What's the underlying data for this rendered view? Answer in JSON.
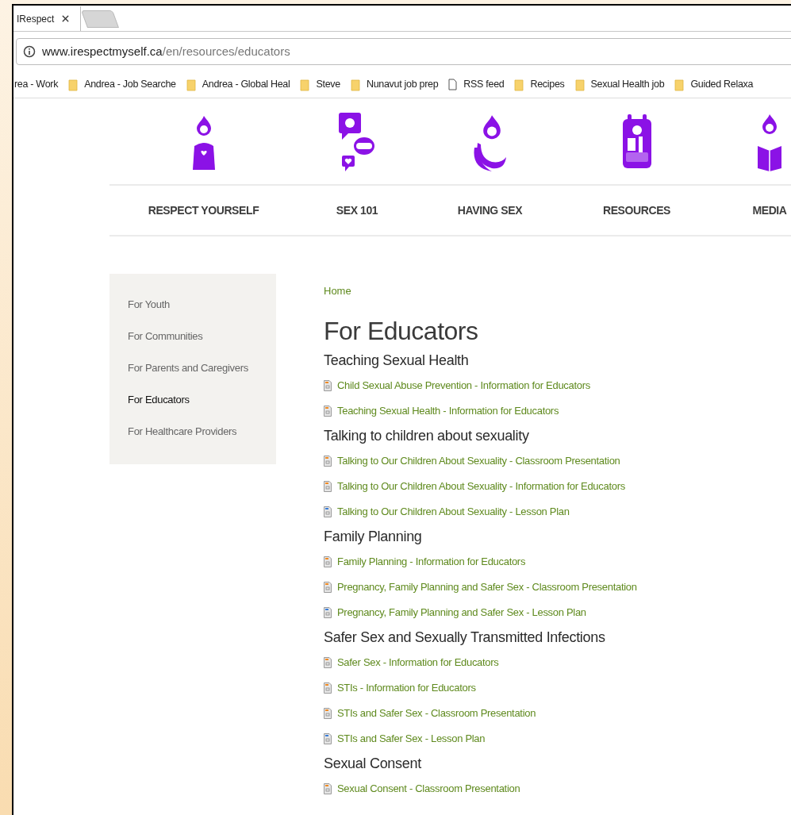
{
  "browser": {
    "tab": {
      "title": "IRespect"
    },
    "address": {
      "host": "www.irespectmyself.ca",
      "path": "/en/resources/educators"
    },
    "bookmarks": [
      {
        "label": "rea - Work",
        "kind": "none"
      },
      {
        "label": "Andrea - Job Searche",
        "kind": "folder"
      },
      {
        "label": "Andrea - Global Heal",
        "kind": "folder"
      },
      {
        "label": "Steve",
        "kind": "folder"
      },
      {
        "label": "Nunavut job prep",
        "kind": "folder"
      },
      {
        "label": "RSS feed",
        "kind": "page"
      },
      {
        "label": "Recipes",
        "kind": "folder"
      },
      {
        "label": "Sexual Health job",
        "kind": "folder"
      },
      {
        "label": "Guided Relaxa",
        "kind": "folder"
      }
    ]
  },
  "nav": [
    {
      "label": "RESPECT YOURSELF",
      "kind": "person"
    },
    {
      "label": "SEX 101",
      "kind": "chat"
    },
    {
      "label": "HAVING SEX",
      "kind": "embrace"
    },
    {
      "label": "RESOURCES",
      "kind": "backpack"
    },
    {
      "label": "MEDIA",
      "kind": "reader"
    }
  ],
  "sidebar": [
    {
      "label": "For Youth",
      "selected": false
    },
    {
      "label": "For Communities",
      "selected": false
    },
    {
      "label": "For Parents and Caregivers",
      "selected": false
    },
    {
      "label": "For Educators",
      "selected": true
    },
    {
      "label": "For Healthcare Providers",
      "selected": false
    }
  ],
  "breadcrumb": "Home",
  "title": "For Educators",
  "sections": [
    {
      "heading": "Teaching Sexual Health",
      "links": [
        {
          "label": "Child Sexual Abuse Prevention - Information for Educators",
          "kind": "document"
        },
        {
          "label": "Teaching Sexual Health - Information for Educators",
          "kind": "document"
        }
      ]
    },
    {
      "heading": "Talking to children about sexuality",
      "links": [
        {
          "label": "Talking to Our Children About Sexuality - Classroom Presentation",
          "kind": "document"
        },
        {
          "label": "Talking to Our Children About Sexuality - Information for Educators",
          "kind": "document"
        },
        {
          "label": "Talking to Our Children About Sexuality - Lesson Plan",
          "kind": "lesson"
        }
      ]
    },
    {
      "heading": "Family Planning",
      "links": [
        {
          "label": "Family Planning - Information for Educators",
          "kind": "document"
        },
        {
          "label": "Pregnancy, Family Planning and Safer Sex - Classroom Presentation",
          "kind": "document"
        },
        {
          "label": "Pregnancy, Family Planning and Safer Sex - Lesson Plan",
          "kind": "lesson"
        }
      ]
    },
    {
      "heading": "Safer Sex and Sexually Transmitted Infections",
      "links": [
        {
          "label": "Safer Sex - Information for Educators",
          "kind": "document"
        },
        {
          "label": "STIs - Information for Educators",
          "kind": "document"
        },
        {
          "label": "STIs and Safer Sex - Classroom Presentation",
          "kind": "document"
        },
        {
          "label": "STIs and Safer Sex - Lesson Plan",
          "kind": "lesson"
        }
      ]
    },
    {
      "heading": "Sexual Consent",
      "links": [
        {
          "label": "Sexual Consent - Classroom Presentation",
          "kind": "document"
        }
      ]
    }
  ]
}
